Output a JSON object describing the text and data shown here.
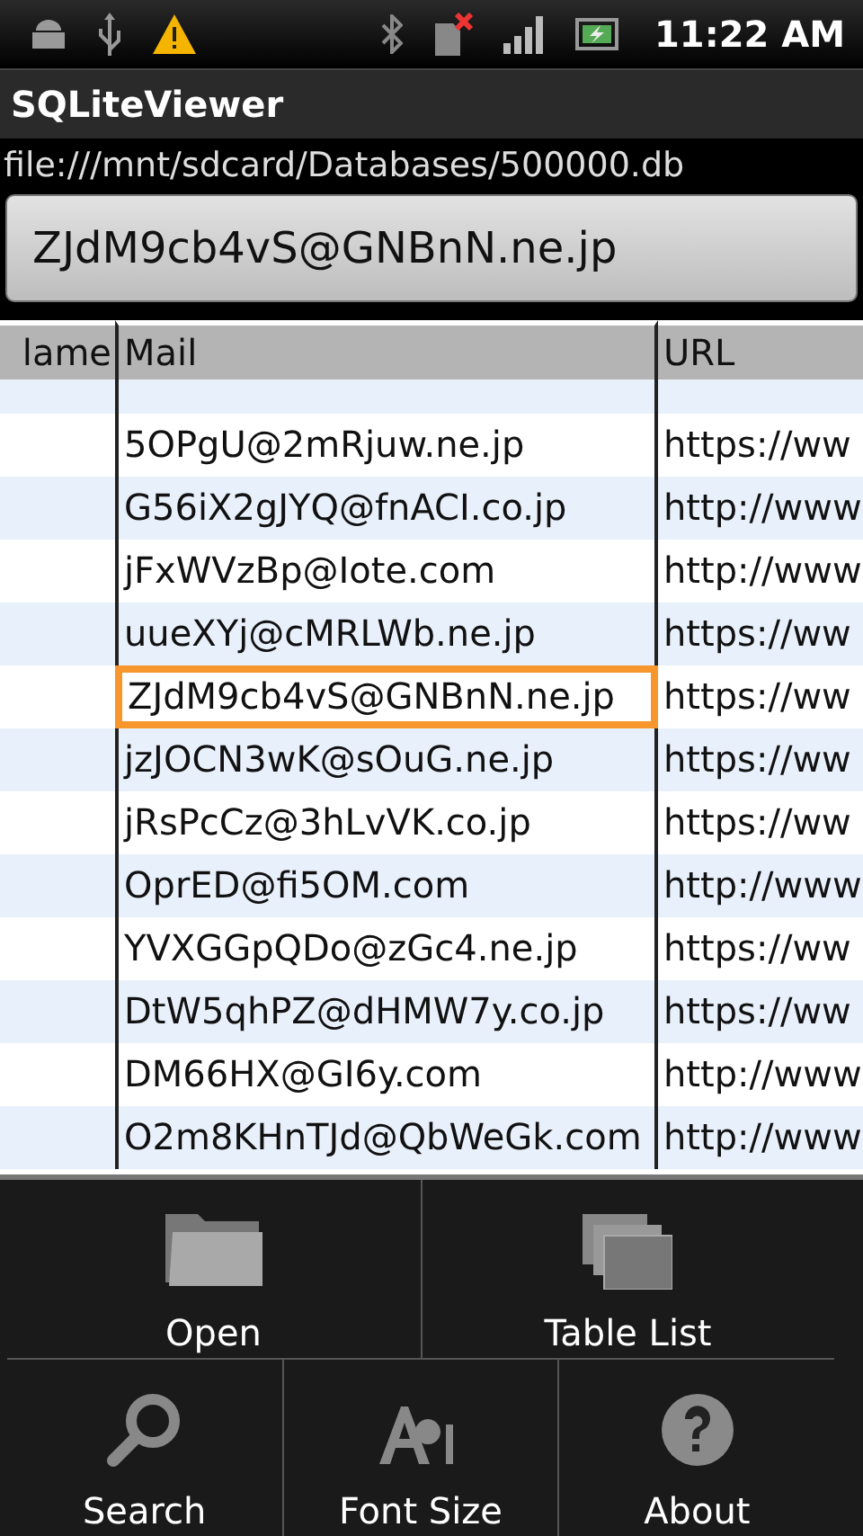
{
  "status_bar": {
    "time": "11:22 AM"
  },
  "title_bar": {
    "title": "SQLiteViewer"
  },
  "path": "file:///mnt/sdcard/Databases/500000.db",
  "selected_value": "ZJdM9cb4vS@GNBnN.ne.jp",
  "table": {
    "columns": [
      "lame",
      "Mail",
      "URL"
    ],
    "rows": [
      {
        "mail": "5OPgU@2mRjuw.ne.jp",
        "url": "https://ww",
        "selected": false
      },
      {
        "mail": "G56iX2gJYQ@fnACI.co.jp",
        "url": "http://www",
        "selected": false
      },
      {
        "mail": "jFxWVzBp@Iote.com",
        "url": "http://www",
        "selected": false
      },
      {
        "mail": "uueXYj@cMRLWb.ne.jp",
        "url": "https://ww",
        "selected": false
      },
      {
        "mail": "ZJdM9cb4vS@GNBnN.ne.jp",
        "url": "https://ww",
        "selected": true
      },
      {
        "mail": "jzJOCN3wK@sOuG.ne.jp",
        "url": "https://ww",
        "selected": false
      },
      {
        "mail": "jRsPcCz@3hLvVK.co.jp",
        "url": "https://ww",
        "selected": false
      },
      {
        "mail": "OprED@fi5OM.com",
        "url": "http://www",
        "selected": false
      },
      {
        "mail": "YVXGGpQDo@zGc4.ne.jp",
        "url": "https://ww",
        "selected": false
      },
      {
        "mail": "DtW5qhPZ@dHMW7y.co.jp",
        "url": "https://ww",
        "selected": false
      },
      {
        "mail": "DM66HX@GI6y.com",
        "url": "http://www",
        "selected": false
      },
      {
        "mail": "O2m8KHnTJd@QbWeGk.com",
        "url": "http://www",
        "selected": false
      }
    ]
  },
  "menu": {
    "items": [
      {
        "label": "Open",
        "kind": "folder"
      },
      {
        "label": "Table List",
        "kind": "tables"
      },
      {
        "label": "Search",
        "kind": "search"
      },
      {
        "label": "Font Size",
        "kind": "font"
      },
      {
        "label": "About",
        "kind": "help"
      }
    ]
  }
}
